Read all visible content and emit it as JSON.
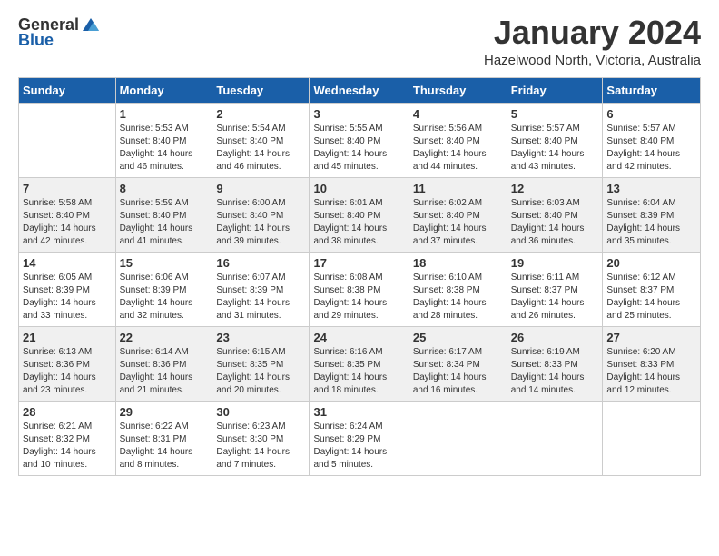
{
  "logo": {
    "general": "General",
    "blue": "Blue"
  },
  "header": {
    "title": "January 2024",
    "subtitle": "Hazelwood North, Victoria, Australia"
  },
  "columns": [
    "Sunday",
    "Monday",
    "Tuesday",
    "Wednesday",
    "Thursday",
    "Friday",
    "Saturday"
  ],
  "weeks": [
    [
      {
        "day": "",
        "info": ""
      },
      {
        "day": "1",
        "info": "Sunrise: 5:53 AM\nSunset: 8:40 PM\nDaylight: 14 hours\nand 46 minutes."
      },
      {
        "day": "2",
        "info": "Sunrise: 5:54 AM\nSunset: 8:40 PM\nDaylight: 14 hours\nand 46 minutes."
      },
      {
        "day": "3",
        "info": "Sunrise: 5:55 AM\nSunset: 8:40 PM\nDaylight: 14 hours\nand 45 minutes."
      },
      {
        "day": "4",
        "info": "Sunrise: 5:56 AM\nSunset: 8:40 PM\nDaylight: 14 hours\nand 44 minutes."
      },
      {
        "day": "5",
        "info": "Sunrise: 5:57 AM\nSunset: 8:40 PM\nDaylight: 14 hours\nand 43 minutes."
      },
      {
        "day": "6",
        "info": "Sunrise: 5:57 AM\nSunset: 8:40 PM\nDaylight: 14 hours\nand 42 minutes."
      }
    ],
    [
      {
        "day": "7",
        "info": "Sunrise: 5:58 AM\nSunset: 8:40 PM\nDaylight: 14 hours\nand 42 minutes."
      },
      {
        "day": "8",
        "info": "Sunrise: 5:59 AM\nSunset: 8:40 PM\nDaylight: 14 hours\nand 41 minutes."
      },
      {
        "day": "9",
        "info": "Sunrise: 6:00 AM\nSunset: 8:40 PM\nDaylight: 14 hours\nand 39 minutes."
      },
      {
        "day": "10",
        "info": "Sunrise: 6:01 AM\nSunset: 8:40 PM\nDaylight: 14 hours\nand 38 minutes."
      },
      {
        "day": "11",
        "info": "Sunrise: 6:02 AM\nSunset: 8:40 PM\nDaylight: 14 hours\nand 37 minutes."
      },
      {
        "day": "12",
        "info": "Sunrise: 6:03 AM\nSunset: 8:40 PM\nDaylight: 14 hours\nand 36 minutes."
      },
      {
        "day": "13",
        "info": "Sunrise: 6:04 AM\nSunset: 8:39 PM\nDaylight: 14 hours\nand 35 minutes."
      }
    ],
    [
      {
        "day": "14",
        "info": "Sunrise: 6:05 AM\nSunset: 8:39 PM\nDaylight: 14 hours\nand 33 minutes."
      },
      {
        "day": "15",
        "info": "Sunrise: 6:06 AM\nSunset: 8:39 PM\nDaylight: 14 hours\nand 32 minutes."
      },
      {
        "day": "16",
        "info": "Sunrise: 6:07 AM\nSunset: 8:39 PM\nDaylight: 14 hours\nand 31 minutes."
      },
      {
        "day": "17",
        "info": "Sunrise: 6:08 AM\nSunset: 8:38 PM\nDaylight: 14 hours\nand 29 minutes."
      },
      {
        "day": "18",
        "info": "Sunrise: 6:10 AM\nSunset: 8:38 PM\nDaylight: 14 hours\nand 28 minutes."
      },
      {
        "day": "19",
        "info": "Sunrise: 6:11 AM\nSunset: 8:37 PM\nDaylight: 14 hours\nand 26 minutes."
      },
      {
        "day": "20",
        "info": "Sunrise: 6:12 AM\nSunset: 8:37 PM\nDaylight: 14 hours\nand 25 minutes."
      }
    ],
    [
      {
        "day": "21",
        "info": "Sunrise: 6:13 AM\nSunset: 8:36 PM\nDaylight: 14 hours\nand 23 minutes."
      },
      {
        "day": "22",
        "info": "Sunrise: 6:14 AM\nSunset: 8:36 PM\nDaylight: 14 hours\nand 21 minutes."
      },
      {
        "day": "23",
        "info": "Sunrise: 6:15 AM\nSunset: 8:35 PM\nDaylight: 14 hours\nand 20 minutes."
      },
      {
        "day": "24",
        "info": "Sunrise: 6:16 AM\nSunset: 8:35 PM\nDaylight: 14 hours\nand 18 minutes."
      },
      {
        "day": "25",
        "info": "Sunrise: 6:17 AM\nSunset: 8:34 PM\nDaylight: 14 hours\nand 16 minutes."
      },
      {
        "day": "26",
        "info": "Sunrise: 6:19 AM\nSunset: 8:33 PM\nDaylight: 14 hours\nand 14 minutes."
      },
      {
        "day": "27",
        "info": "Sunrise: 6:20 AM\nSunset: 8:33 PM\nDaylight: 14 hours\nand 12 minutes."
      }
    ],
    [
      {
        "day": "28",
        "info": "Sunrise: 6:21 AM\nSunset: 8:32 PM\nDaylight: 14 hours\nand 10 minutes."
      },
      {
        "day": "29",
        "info": "Sunrise: 6:22 AM\nSunset: 8:31 PM\nDaylight: 14 hours\nand 8 minutes."
      },
      {
        "day": "30",
        "info": "Sunrise: 6:23 AM\nSunset: 8:30 PM\nDaylight: 14 hours\nand 7 minutes."
      },
      {
        "day": "31",
        "info": "Sunrise: 6:24 AM\nSunset: 8:29 PM\nDaylight: 14 hours\nand 5 minutes."
      },
      {
        "day": "",
        "info": ""
      },
      {
        "day": "",
        "info": ""
      },
      {
        "day": "",
        "info": ""
      }
    ]
  ]
}
